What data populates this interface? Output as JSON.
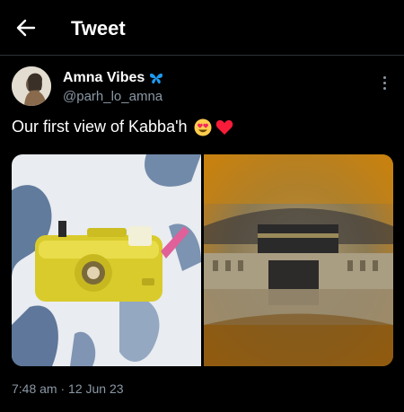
{
  "header": {
    "title": "Tweet"
  },
  "tweet": {
    "display_name": "Amna Vibes",
    "handle": "@parh_lo_amna",
    "text": "Our first view of Kabba'h",
    "emojis": [
      "heart-eyes-emoji",
      "red-heart-emoji"
    ],
    "timestamp": "7:48 am · 12 Jun 23"
  },
  "icons": {
    "back": "arrow-left-icon",
    "badge": "butterfly-icon",
    "more": "more-vertical-icon"
  },
  "colors": {
    "background": "#000000",
    "text": "#e7e9ea",
    "secondary_text": "#8b98a5",
    "badge": "#1d9bf0",
    "heart": "#f91c3a"
  }
}
